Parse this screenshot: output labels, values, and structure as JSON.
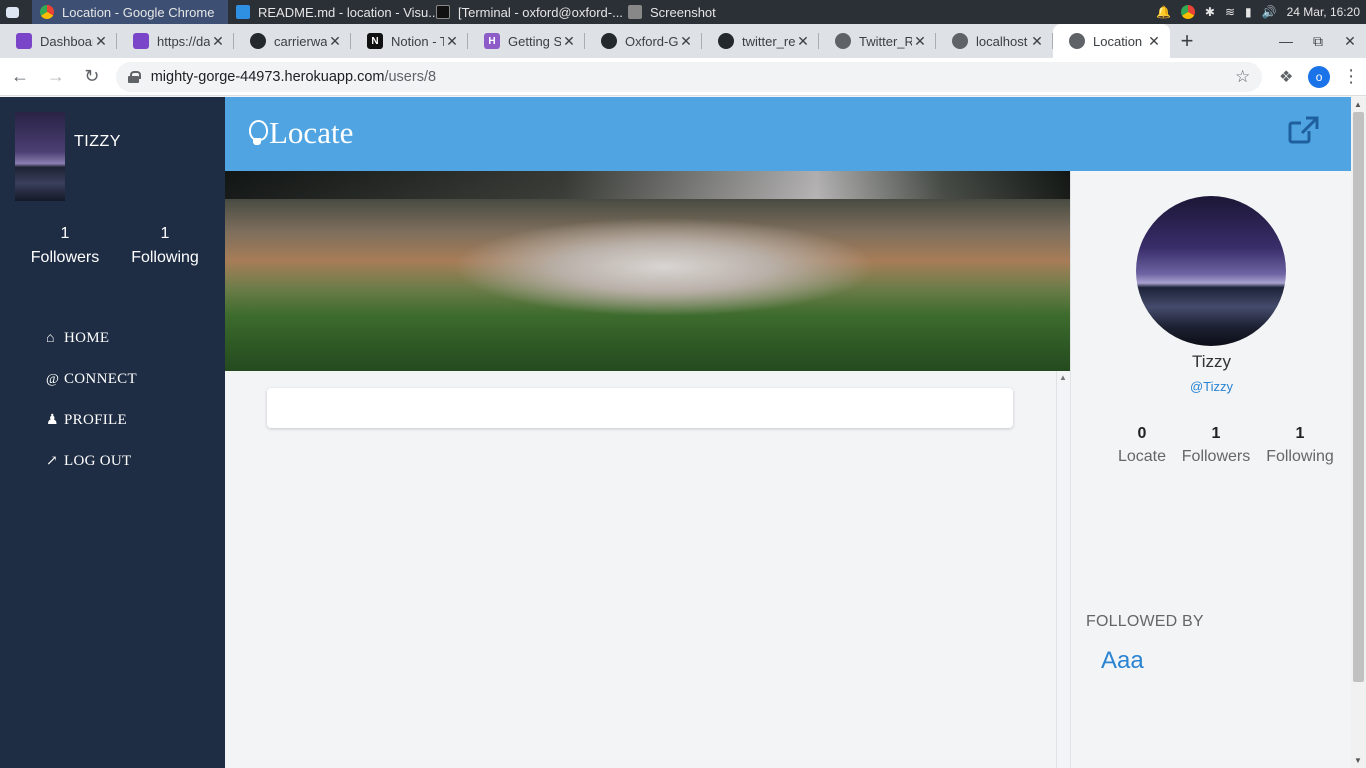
{
  "taskbar": {
    "tasks": [
      {
        "label": "Location - Google Chrome",
        "color": "#4285f4"
      },
      {
        "label": "README.md - location - Visu...",
        "color": "#2f8fe0"
      },
      {
        "label": "[Terminal - oxford@oxford-...",
        "color": "#444444"
      },
      {
        "label": "Screenshot",
        "color": "#888888"
      }
    ],
    "clock": "24 Mar, 16:20"
  },
  "tabs": [
    {
      "label": "Dashboard",
      "favicon": "heroku-icon",
      "color": "#7b45c9"
    },
    {
      "label": "https://da",
      "favicon": "heroku-icon",
      "color": "#7b45c9"
    },
    {
      "label": "carrierwa",
      "favicon": "github-icon",
      "color": "#24292e"
    },
    {
      "label": "Notion - T",
      "favicon": "notion-icon",
      "color": "#111111"
    },
    {
      "label": "Getting St",
      "favicon": "heroku-icon",
      "color": "#8e5cc9"
    },
    {
      "label": "Oxford-G",
      "favicon": "github-icon",
      "color": "#24292e"
    },
    {
      "label": "twitter_re",
      "favicon": "github-icon",
      "color": "#24292e"
    },
    {
      "label": "Twitter_Re",
      "favicon": "globe-icon",
      "color": "#5f6368"
    },
    {
      "label": "localhost",
      "favicon": "globe-icon",
      "color": "#5f6368"
    },
    {
      "label": "Location",
      "favicon": "globe-icon",
      "color": "#5f6368"
    }
  ],
  "omnibox": {
    "host": "mighty-gorge-44973.herokuapp.com",
    "path": "/users/8"
  },
  "chrome_profile_initial": "o",
  "sidebar": {
    "name": "TIZZY",
    "followers_count": "1",
    "followers_label": "Followers",
    "following_count": "1",
    "following_label": "Following",
    "nav": [
      {
        "label": "HOME",
        "icon": "home-icon"
      },
      {
        "label": "CONNECT",
        "icon": "at-icon"
      },
      {
        "label": "PROFILE",
        "icon": "user-icon"
      },
      {
        "label": "LOG OUT",
        "icon": "external-link-icon"
      }
    ]
  },
  "header": {
    "brand": "Locate",
    "color": "#4fa4e1"
  },
  "profile": {
    "name": "Tizzy",
    "handle": "@Tizzy",
    "stats": [
      {
        "value": "0",
        "label": "Locate"
      },
      {
        "value": "1",
        "label": "Followers"
      },
      {
        "value": "1",
        "label": "Following"
      }
    ],
    "followed_by_title": "FOLLOWED BY",
    "followed_by": [
      "Aaa"
    ]
  },
  "colors": {
    "sidebar_bg": "#1f2d44",
    "link": "#2a84d2"
  }
}
